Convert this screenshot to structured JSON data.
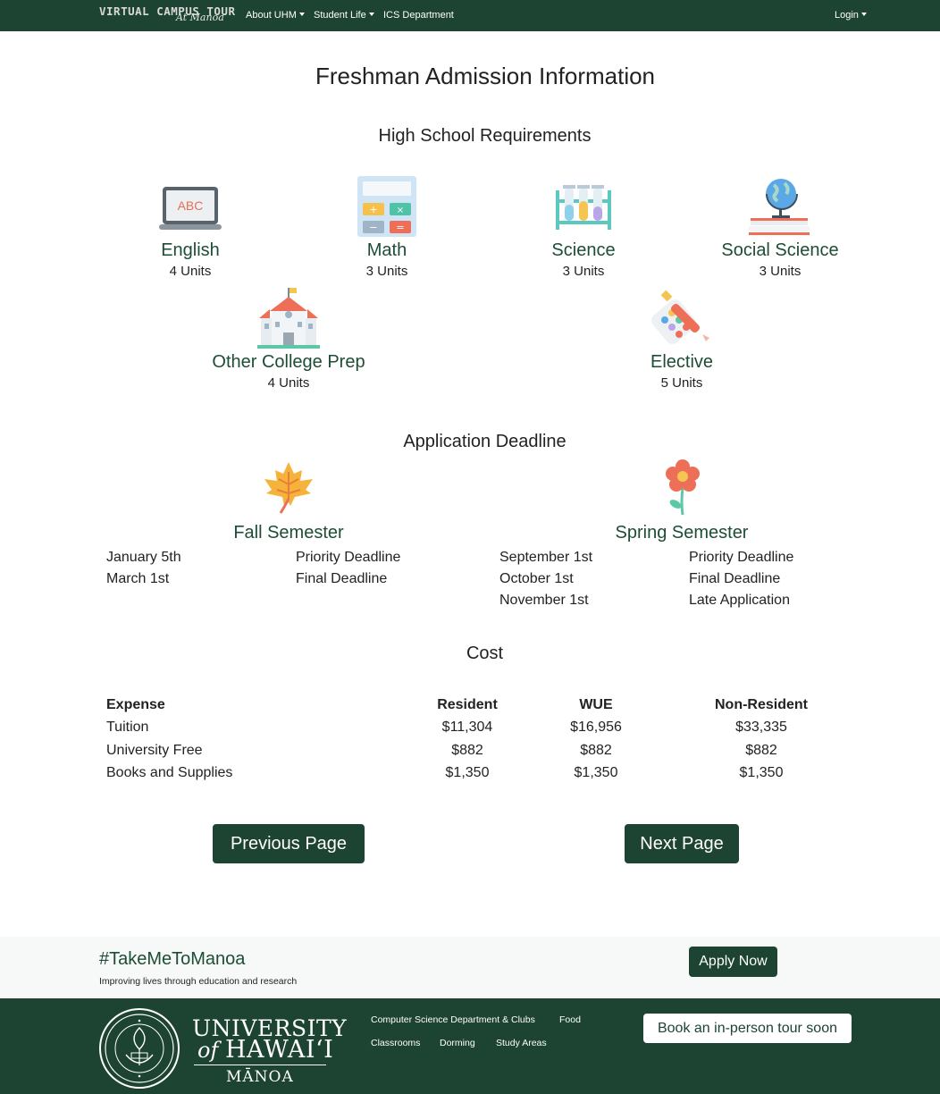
{
  "nav": {
    "brand_line1": "VIRTUAL CAMPUS TOUR",
    "brand_line2": "At Manoa",
    "items": [
      {
        "label": "About UHM",
        "dropdown": true
      },
      {
        "label": "Student Life",
        "dropdown": true
      },
      {
        "label": "ICS Department",
        "dropdown": false
      }
    ],
    "login": "Login"
  },
  "page_title": "Freshman Admission Information",
  "requirements": {
    "heading": "High School Requirements",
    "subjects": [
      {
        "name": "English",
        "units": "4 Units",
        "icon": "laptop-abc-icon"
      },
      {
        "name": "Math",
        "units": "3 Units",
        "icon": "calculator-icon"
      },
      {
        "name": "Science",
        "units": "3 Units",
        "icon": "test-tubes-icon"
      },
      {
        "name": "Social Science",
        "units": "3 Units",
        "icon": "globe-books-icon"
      },
      {
        "name": "Other College Prep",
        "units": "4 Units",
        "icon": "school-building-icon"
      },
      {
        "name": "Elective",
        "units": "5 Units",
        "icon": "paint-palette-icon"
      }
    ]
  },
  "deadlines": {
    "heading": "Application Deadline",
    "fall": {
      "title": "Fall Semester",
      "icon": "maple-leaf-icon",
      "rows": [
        {
          "date": "January 5th",
          "label": "Priority Deadline"
        },
        {
          "date": "March 1st",
          "label": "Final Deadline"
        }
      ]
    },
    "spring": {
      "title": "Spring Semester",
      "icon": "flower-icon",
      "rows": [
        {
          "date": "September 1st",
          "label": "Priority Deadline"
        },
        {
          "date": "October 1st",
          "label": "Final Deadline"
        },
        {
          "date": "November 1st",
          "label": "Late Application"
        }
      ]
    }
  },
  "cost": {
    "heading": "Cost",
    "headers": [
      "Expense",
      "Resident",
      "WUE",
      "Non-Resident"
    ],
    "rows": [
      [
        "Tuition",
        "$11,304",
        "$16,956",
        "$33,335"
      ],
      [
        "University Free",
        "$882",
        "$882",
        "$882"
      ],
      [
        "Books and Supplies",
        "$1,350",
        "$1,350",
        "$1,350"
      ]
    ]
  },
  "buttons": {
    "previous": "Previous Page",
    "next": "Next Page"
  },
  "promo": {
    "hashtag": "#TakeMeToManoa",
    "tagline": "Improving lives through education and research",
    "apply": "Apply Now"
  },
  "footer": {
    "university_line1": "UNIVERSITY",
    "university_of": "of",
    "university_line2": "HAWAIʻI",
    "campus": "MĀNOA",
    "links_row1": [
      "Computer Science Department & Clubs",
      "Food"
    ],
    "links_row2": [
      "Classrooms",
      "Dorming",
      "Study Areas"
    ],
    "book_tour": "Book an in-person tour soon"
  },
  "colors": {
    "brand_green": "#1d4332",
    "heading_green": "#1d4d35",
    "promo_bg": "#f7f8f8"
  }
}
